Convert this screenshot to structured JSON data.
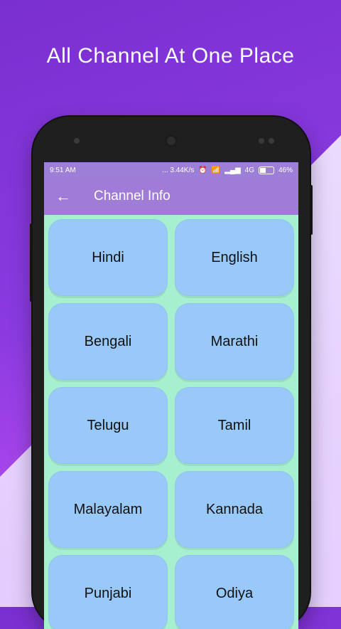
{
  "promo": {
    "headline": "All Channel At One Place"
  },
  "status_bar": {
    "time": "9:51 AM",
    "network_speed": "... 3.44K/s",
    "network_type": "4G",
    "battery": "46%"
  },
  "app_bar": {
    "title": "Channel Info",
    "back_icon": "arrow-left-icon"
  },
  "languages": [
    {
      "label": "Hindi"
    },
    {
      "label": "English"
    },
    {
      "label": "Bengali"
    },
    {
      "label": "Marathi"
    },
    {
      "label": "Telugu"
    },
    {
      "label": "Tamil"
    },
    {
      "label": "Malayalam"
    },
    {
      "label": "Kannada"
    },
    {
      "label": "Punjabi"
    },
    {
      "label": "Odiya"
    }
  ],
  "colors": {
    "toolbar": "#a07bd7",
    "content_bg": "#a6f0cf",
    "card": "#99c9f8",
    "background_top": "#7a2fd0"
  }
}
